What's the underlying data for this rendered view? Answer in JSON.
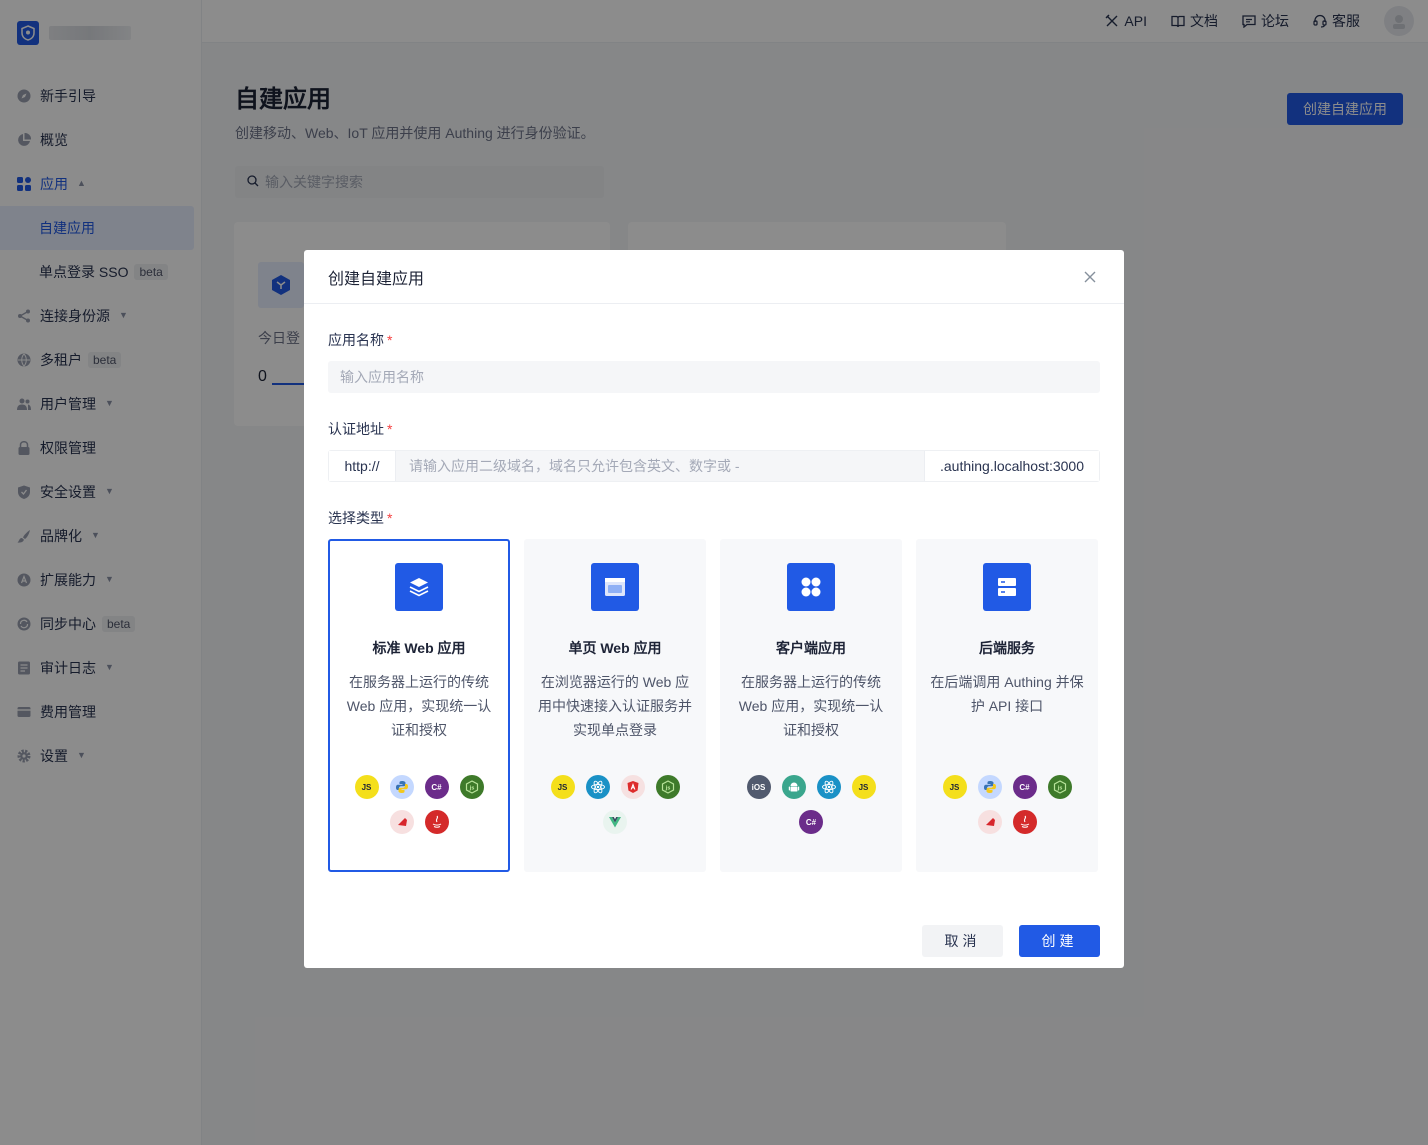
{
  "sidebar": {
    "items": [
      {
        "label": "新手引导",
        "icon": "compass-icon",
        "caret": false
      },
      {
        "label": "概览",
        "icon": "pie-chart-icon",
        "caret": false
      },
      {
        "label": "应用",
        "icon": "apps-icon",
        "caret": true,
        "expanded": true
      },
      {
        "label": "连接身份源",
        "icon": "share-icon",
        "caret": true
      },
      {
        "label": "多租户",
        "icon": "globe-icon",
        "badge": "beta"
      },
      {
        "label": "用户管理",
        "icon": "users-icon",
        "caret": true
      },
      {
        "label": "权限管理",
        "icon": "lock-icon",
        "caret": false
      },
      {
        "label": "安全设置",
        "icon": "shield-icon",
        "caret": true
      },
      {
        "label": "品牌化",
        "icon": "brush-icon",
        "caret": true
      },
      {
        "label": "扩展能力",
        "icon": "extension-icon",
        "caret": true
      },
      {
        "label": "同步中心",
        "icon": "sync-icon",
        "badge": "beta"
      },
      {
        "label": "审计日志",
        "icon": "log-icon",
        "caret": true
      },
      {
        "label": "费用管理",
        "icon": "card-icon",
        "caret": false
      },
      {
        "label": "设置",
        "icon": "gear-icon",
        "caret": true
      }
    ],
    "sub_items": [
      {
        "label": "自建应用",
        "selected": true
      },
      {
        "label": "单点登录 SSO",
        "badge": "beta"
      }
    ]
  },
  "topbar": {
    "api": "API",
    "docs": "文档",
    "forum": "论坛",
    "support": "客服"
  },
  "page": {
    "title": "自建应用",
    "subtitle": "创建移动、Web、IoT 应用并使用 Authing 进行身份验证。",
    "create_button": "创建自建应用",
    "search_placeholder": "输入关键字搜索",
    "card_label": "今日登",
    "card_value": "0"
  },
  "modal": {
    "title": "创建自建应用",
    "app_name_label": "应用名称",
    "app_name_placeholder": "输入应用名称",
    "auth_url_label": "认证地址",
    "url_prefix": "http://",
    "url_placeholder": "请输入应用二级域名，域名只允许包含英文、数字或 -",
    "url_suffix": ".authing.localhost:3000",
    "type_label": "选择类型",
    "required_mark": "*",
    "types": [
      {
        "title": "标准 Web 应用",
        "desc": "在服务器上运行的传统 Web 应用，实现统一认证和授权",
        "selected": true,
        "icon": "layers-icon",
        "techs": [
          "js",
          "python",
          "csharp",
          "nodejs",
          "ruby",
          "java"
        ]
      },
      {
        "title": "单页 Web 应用",
        "desc": "在浏览器运行的 Web 应用中快速接入认证服务并实现单点登录",
        "selected": false,
        "icon": "browser-icon",
        "techs": [
          "js",
          "react",
          "angular",
          "nodejs",
          "vue"
        ]
      },
      {
        "title": "客户端应用",
        "desc": "在服务器上运行的传统 Web 应用，实现统一认证和授权",
        "selected": false,
        "icon": "grid-icon",
        "techs": [
          "ios",
          "android",
          "react",
          "js",
          "csharp"
        ]
      },
      {
        "title": "后端服务",
        "desc": "在后端调用 Authing 并保护 API 接口",
        "selected": false,
        "icon": "server-icon",
        "techs": [
          "js",
          "python",
          "csharp",
          "nodejs",
          "ruby",
          "java"
        ]
      }
    ],
    "tech_labels": {
      "js": "JS",
      "ios": "iOS",
      "csharp": "C#"
    },
    "cancel": "取消",
    "ok": "创建"
  },
  "colors": {
    "primary": "#215ae5",
    "required": "#f53f3f",
    "overlay": "rgba(0,0,0,0.45)"
  }
}
